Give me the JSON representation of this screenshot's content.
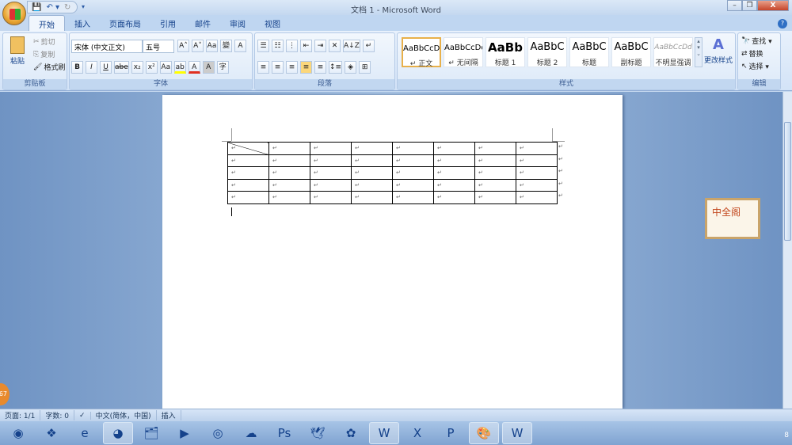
{
  "window": {
    "title": "文档 1 - Microsoft Word",
    "minimize": "–",
    "restore": "❐",
    "close": "X"
  },
  "qat": {
    "save": "💾",
    "undo": "↶ ▾",
    "redo": "↻",
    "customize": "▾"
  },
  "tabs": [
    "开始",
    "插入",
    "页面布局",
    "引用",
    "邮件",
    "审阅",
    "视图"
  ],
  "clipboard": {
    "paste": "粘贴",
    "cut": "剪切",
    "copy": "复制",
    "format_painter": "格式刷",
    "label": "剪贴板"
  },
  "font": {
    "name": "宋体 (中文正文)",
    "size": "五号",
    "grow": "A˄",
    "shrink": "A˅",
    "clear": "Aa",
    "phonetic": "變",
    "border": "A",
    "bold": "B",
    "italic": "I",
    "underline": "U",
    "strike": "abe",
    "sub": "x₂",
    "sup": "x²",
    "case": "Aa",
    "highlight": "ab",
    "color": "A",
    "shade": "A",
    "enclose": "字",
    "label": "字体"
  },
  "paragraph": {
    "bullets": "☰",
    "numbering": "☷",
    "multilevel": "⋮",
    "dec_indent": "⇤",
    "inc_indent": "⇥",
    "chinese": "✕",
    "sort": "A↓Z",
    "marks": "↵",
    "left": "≡",
    "center": "≡",
    "right": "≡",
    "justify": "≡",
    "distributed": "≡",
    "spacing": "↕≡",
    "fill": "◈",
    "borders": "⊞",
    "label": "段落"
  },
  "styles": {
    "items": [
      {
        "sample": "AaBbCcDd",
        "name": "↵ 正文"
      },
      {
        "sample": "AaBbCcDd",
        "name": "↵ 无间隔"
      },
      {
        "sample": "AaBb",
        "name": "标题 1"
      },
      {
        "sample": "AaBbC",
        "name": "标题 2"
      },
      {
        "sample": "AaBbC",
        "name": "标题"
      },
      {
        "sample": "AaBbC",
        "name": "副标题"
      },
      {
        "sample": "AaBbCcDd",
        "name": "不明显强调"
      }
    ],
    "change": "更改样式",
    "label": "样式"
  },
  "editing": {
    "find": "查找 ▾",
    "replace": "替换",
    "select": "选择 ▾",
    "label": "编辑"
  },
  "document": {
    "rows": 5,
    "cols": 8,
    "cell_mark": "↵"
  },
  "sticker": {
    "text": "中全阁"
  },
  "badge": "67",
  "status": {
    "page": "页面: 1/1",
    "words": "字数: 0",
    "language": "中文(简体，中国)",
    "mode": "插入"
  },
  "taskbar": {
    "icons": [
      "start",
      "app-colors",
      "internet-explorer",
      "color-wheel",
      "file-explorer",
      "video-player",
      "pptv",
      "baidu-cloud",
      "photoshop",
      "bird-app",
      "fruit-app",
      "word",
      "excel",
      "powerpoint",
      "paint",
      "wps"
    ],
    "clock": "8"
  }
}
